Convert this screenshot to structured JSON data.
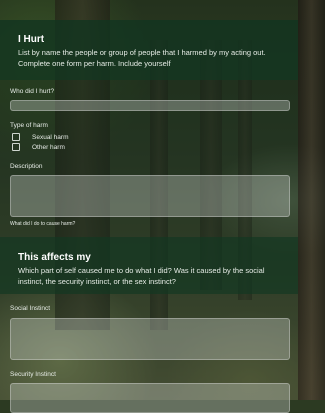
{
  "header": {
    "title": "I Hurt",
    "subtitle": "List by name the people or group of people that I harmed by my acting out. Complete one form per harm. Include yourself"
  },
  "section1": {
    "who_label": "Who did I hurt?",
    "type_label": "Type of harm",
    "options": [
      "Sexual harm",
      "Other harm"
    ],
    "description_label": "Description",
    "description_help": "What did I do to cause harm?"
  },
  "header2": {
    "title": "This affects my",
    "subtitle": "Which part of self caused me to do what I did? Was it caused by the social instinct, the security instinct, or the sex instinct?"
  },
  "section2": {
    "social_label": "Social Instinct",
    "security_label": "Security Instinct"
  }
}
